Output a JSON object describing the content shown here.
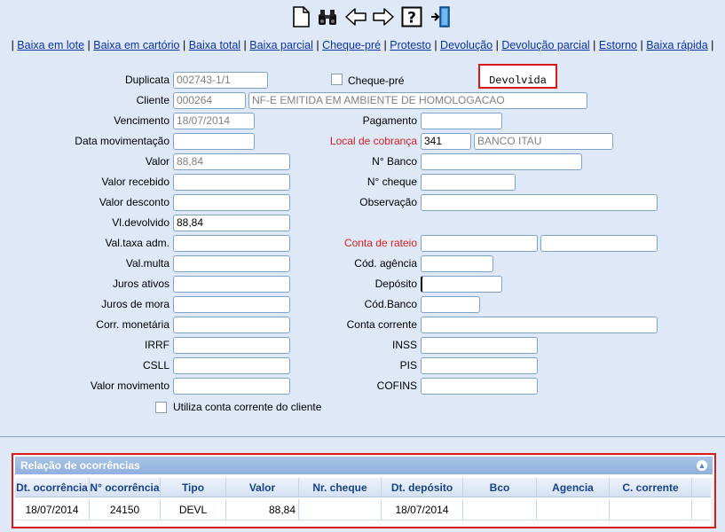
{
  "toolbar": {
    "icons": [
      "new-document-icon",
      "binoculars-search-icon",
      "arrow-left-icon",
      "arrow-right-icon",
      "help-question-icon",
      "exit-door-icon"
    ]
  },
  "nav_links": [
    "Baixa em lote",
    "Baixa em cartório",
    "Baixa total",
    "Baixa parcial",
    "Cheque-pré",
    "Protesto",
    "Devolução",
    "Devolução parcial",
    "Estorno",
    "Baixa rápida"
  ],
  "status": "Devolvida",
  "form": {
    "duplicata": {
      "label": "Duplicata",
      "value": "002743-1/1"
    },
    "cheque_pre": {
      "label": "Cheque-pré",
      "checked": false
    },
    "cliente": {
      "label": "Cliente",
      "code": "000264",
      "name": "NF-E EMITIDA EM AMBIENTE DE HOMOLOGACAO"
    },
    "vencimento": {
      "label": "Vencimento",
      "value": "18/07/2014"
    },
    "pagamento": {
      "label": "Pagamento",
      "value": ""
    },
    "data_movimentacao": {
      "label": "Data movimentação",
      "value": ""
    },
    "local_cobranca": {
      "label": "Local de cobrança",
      "code": "341",
      "name": "BANCO ITAU"
    },
    "valor": {
      "label": "Valor",
      "value": "88,84"
    },
    "n_banco": {
      "label": "N° Banco",
      "value": ""
    },
    "valor_recebido": {
      "label": "Valor recebido",
      "value": ""
    },
    "n_cheque": {
      "label": "N° cheque",
      "value": ""
    },
    "valor_desconto": {
      "label": "Valor desconto",
      "value": ""
    },
    "observacao": {
      "label": "Observação",
      "value": ""
    },
    "vl_devolvido": {
      "label": "Vl.devolvido",
      "value": "88,84"
    },
    "val_taxa_adm": {
      "label": "Val.taxa adm.",
      "value": ""
    },
    "conta_rateio": {
      "label": "Conta de rateio",
      "value1": "",
      "value2": ""
    },
    "val_multa": {
      "label": "Val.multa",
      "value": ""
    },
    "cod_agencia": {
      "label": "Cód. agência",
      "value": ""
    },
    "juros_ativos": {
      "label": "Juros ativos",
      "value": ""
    },
    "deposito": {
      "label": "Depósito",
      "value": ""
    },
    "juros_mora": {
      "label": "Juros de mora",
      "value": ""
    },
    "cod_banco": {
      "label": "Cód.Banco",
      "value": ""
    },
    "corr_monetaria": {
      "label": "Corr. monetária",
      "value": ""
    },
    "conta_corrente": {
      "label": "Conta corrente",
      "value": ""
    },
    "irrf": {
      "label": "IRRF",
      "value": ""
    },
    "inss": {
      "label": "INSS",
      "value": ""
    },
    "csll": {
      "label": "CSLL",
      "value": ""
    },
    "pis": {
      "label": "PIS",
      "value": ""
    },
    "valor_movimento": {
      "label": "Valor movimento",
      "value": ""
    },
    "cofins": {
      "label": "COFINS",
      "value": ""
    },
    "utiliza_cc": {
      "label": "Utiliza conta corrente do cliente",
      "checked": false
    }
  },
  "grid": {
    "title": "Relação de ocorrências",
    "columns": [
      "Dt. ocorrência",
      "N° ocorrência",
      "Tipo",
      "Valor",
      "Nr. cheque",
      "Dt. depósito",
      "Bco",
      "Agencia",
      "C. corrente"
    ],
    "rows": [
      [
        "18/07/2014",
        "24150",
        "DEVL",
        "88,84",
        "",
        "18/07/2014",
        "",
        "",
        ""
      ]
    ]
  },
  "colors": {
    "background": "#dfe8f6",
    "link": "#0a33a8",
    "highlight_border": "#d91a1a",
    "required_label": "#d81e1e"
  }
}
